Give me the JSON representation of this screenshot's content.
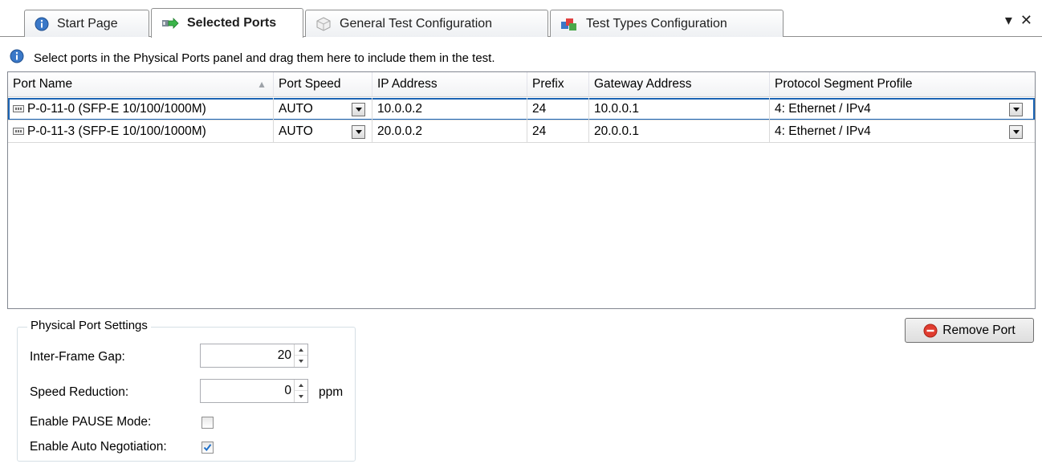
{
  "tabs": [
    {
      "label": "Start Page",
      "icon": "info-icon"
    },
    {
      "label": "Selected Ports",
      "icon": "ports-arrow-icon",
      "active": true
    },
    {
      "label": "General Test Configuration",
      "icon": "config-icon"
    },
    {
      "label": "Test Types Configuration",
      "icon": "test-types-icon"
    }
  ],
  "window_controls": {
    "menu": "▾",
    "close": "✕"
  },
  "info_text": "Select ports in the Physical Ports panel and drag them here to include them in the test.",
  "grid": {
    "columns": [
      "Port Name",
      "Port Speed",
      "IP Address",
      "Prefix",
      "Gateway Address",
      "Protocol Segment Profile"
    ],
    "rows": [
      {
        "port_name": "P-0-11-0 (SFP-E 10/100/1000M)",
        "port_speed": "AUTO",
        "ip_address": "10.0.0.2",
        "prefix": "24",
        "gateway": "10.0.0.1",
        "profile": "4: Ethernet / IPv4",
        "selected": true
      },
      {
        "port_name": "P-0-11-3 (SFP-E 10/100/1000M)",
        "port_speed": "AUTO",
        "ip_address": "20.0.0.2",
        "prefix": "24",
        "gateway": "20.0.0.1",
        "profile": "4: Ethernet / IPv4",
        "selected": false
      }
    ]
  },
  "port_settings": {
    "title": "Physical Port Settings",
    "inter_frame_gap_label": "Inter-Frame Gap:",
    "inter_frame_gap_value": "20",
    "speed_reduction_label": "Speed Reduction:",
    "speed_reduction_value": "0",
    "speed_reduction_unit": "ppm",
    "pause_mode_label": "Enable PAUSE Mode:",
    "pause_mode_checked": false,
    "auto_neg_label": "Enable Auto Negotiation:",
    "auto_neg_checked": true
  },
  "remove_button": "Remove Port",
  "colors": {
    "selection": "#1b64b4",
    "accent": "#1e6fc8",
    "remove_icon": "#e03c2f"
  }
}
